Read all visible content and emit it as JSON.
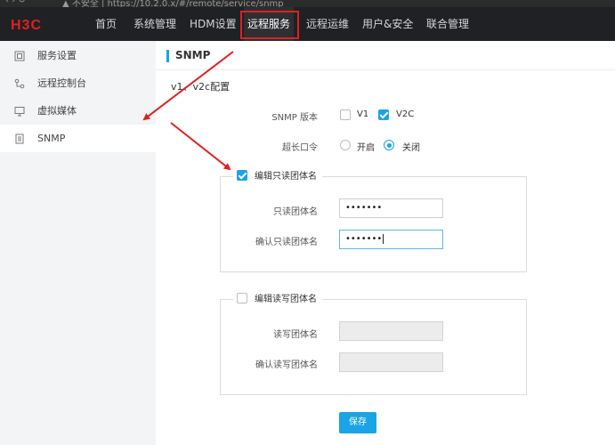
{
  "browser": {
    "nav_glyphs": "‹  ›  ↻",
    "url_text": "▲ 不安全 | https://10.2.0.x/#/remote/service/snmp"
  },
  "topnav": {
    "logo_text": "H3C",
    "items": [
      {
        "label": "首页"
      },
      {
        "label": "系统管理"
      },
      {
        "label": "HDM设置"
      },
      {
        "label": "远程服务"
      },
      {
        "label": "远程运维"
      },
      {
        "label": "用户&安全"
      },
      {
        "label": "联合管理"
      }
    ],
    "active_index": 3,
    "highlight_color": "#e02020"
  },
  "sidebar": {
    "items": [
      {
        "label": "服务设置",
        "icon": "service-settings-icon"
      },
      {
        "label": "远程控制台",
        "icon": "remote-console-icon"
      },
      {
        "label": "虚拟媒体",
        "icon": "virtual-media-icon"
      },
      {
        "label": "SNMP",
        "icon": "snmp-icon"
      }
    ],
    "active_index": 3
  },
  "main": {
    "page_title": "SNMP",
    "section_title": "v1、v2c配置",
    "snmp_version": {
      "label": "SNMP 版本",
      "options": [
        {
          "label": "V1",
          "checked": false
        },
        {
          "label": "V2C",
          "checked": true
        }
      ]
    },
    "long_password": {
      "label": "超长口令",
      "options": [
        {
          "label": "开启",
          "checked": false
        },
        {
          "label": "关闭",
          "checked": true
        }
      ]
    },
    "readonly_group": {
      "legend": "编辑只读团体名",
      "checked": true,
      "fields": [
        {
          "label": "只读团体名",
          "value": "•••••••",
          "state": "normal"
        },
        {
          "label": "确认只读团体名",
          "value": "•••••••",
          "state": "focused"
        }
      ]
    },
    "readwrite_group": {
      "legend": "编辑读写团体名",
      "checked": false,
      "fields": [
        {
          "label": "读写团体名",
          "value": "",
          "state": "disabled"
        },
        {
          "label": "确认读写团体名",
          "value": "",
          "state": "disabled"
        }
      ]
    },
    "save_label": "保存"
  },
  "colors": {
    "accent": "#1aa4e6",
    "annotation_red": "#e02020",
    "nav_bg": "#1f2124"
  }
}
